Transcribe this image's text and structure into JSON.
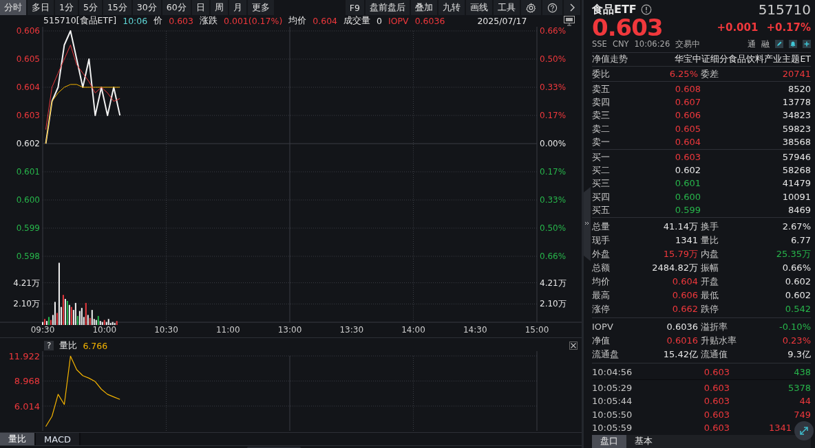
{
  "toolbar": {
    "periods": [
      {
        "label": "分时",
        "selected": true
      },
      {
        "label": "多日",
        "selected": false
      },
      {
        "label": "1分",
        "selected": false
      },
      {
        "label": "5分",
        "selected": false
      },
      {
        "label": "15分",
        "selected": false
      },
      {
        "label": "30分",
        "selected": false
      },
      {
        "label": "60分",
        "selected": false
      },
      {
        "label": "日",
        "selected": false
      },
      {
        "label": "周",
        "selected": false
      },
      {
        "label": "月",
        "selected": false
      },
      {
        "label": "更多",
        "selected": false
      }
    ],
    "tools": [
      "F9",
      "盘前盘后",
      "叠加",
      "九转",
      "画线",
      "工具"
    ]
  },
  "chart_header": {
    "code_name": "515710[食品ETF]",
    "time": "10:06",
    "price_label": "价",
    "price": "0.603",
    "change_label": "涨跌",
    "change": "0.001(0.17%)",
    "avg_label": "均价",
    "avg": "0.604",
    "volume_label": "成交量",
    "volume": "0",
    "iopv_label": "IOPV",
    "iopv": "0.6036",
    "date": "2025/07/17"
  },
  "price_chart": {
    "percent_ticks": [
      "0.66%",
      "0.50%",
      "0.33%",
      "0.17%",
      "0.00%",
      "0.17%",
      "0.33%",
      "0.50%",
      "0.66%"
    ],
    "chart_data": {
      "type": "line",
      "grid": true,
      "categories": [
        null,
        null,
        null,
        null,
        null,
        null,
        null,
        null,
        null,
        null,
        null,
        null,
        null,
        null,
        null,
        null,
        null,
        null,
        null,
        null,
        null,
        null,
        null,
        null,
        null,
        null,
        null,
        null,
        null,
        null,
        null,
        null,
        null,
        null,
        null,
        null,
        null,
        null,
        null,
        null,
        null,
        null,
        null,
        null,
        null,
        null,
        null,
        null,
        null,
        null,
        null,
        null,
        null,
        null,
        null,
        null,
        null,
        null,
        null,
        null,
        null,
        null,
        null,
        null,
        null,
        null,
        null,
        null,
        null,
        null,
        null,
        null,
        null,
        null,
        null,
        null,
        null,
        null,
        null,
        null
      ],
      "ylim": [
        0.598,
        0.606
      ],
      "yticks": [
        {
          "value": 0.606,
          "label": "0.606"
        },
        {
          "value": 0.605,
          "label": "0.605"
        },
        {
          "value": 0.604,
          "label": "0.604"
        },
        {
          "value": 0.603,
          "label": "0.603"
        },
        {
          "value": 0.602,
          "label": "0.602"
        },
        {
          "value": 0.601,
          "label": "0.601"
        },
        {
          "value": 0.6,
          "label": "0.600"
        },
        {
          "value": 0.599,
          "label": "0.599"
        },
        {
          "value": 0.598,
          "label": "0.598"
        }
      ],
      "series": [
        {
          "color": "#f2f2f2",
          "values": [
            0.602,
            0.6035,
            0.604,
            0.6055,
            0.606,
            0.605,
            0.604,
            0.605,
            0.603,
            0.604,
            0.603,
            0.604,
            0.603,
            null,
            null,
            null,
            null,
            null,
            null,
            null,
            null,
            null,
            null,
            null,
            null,
            null,
            null,
            null,
            null,
            null,
            null,
            null,
            null,
            null,
            null,
            null,
            null,
            null,
            null,
            null,
            null,
            null,
            null,
            null,
            null,
            null,
            null,
            null,
            null,
            null,
            null,
            null,
            null,
            null,
            null,
            null,
            null,
            null,
            null,
            null,
            null,
            null,
            null,
            null,
            null,
            null,
            null,
            null,
            null,
            null,
            null,
            null,
            null,
            null,
            null,
            null,
            null,
            null,
            null,
            null
          ]
        },
        {
          "color": "#f5b400",
          "values": [
            0.602,
            0.6035,
            0.6038,
            0.604,
            0.6041,
            0.6041,
            0.604,
            0.604,
            0.604,
            0.604,
            0.604,
            0.604,
            0.604,
            null,
            null,
            null,
            null,
            null,
            null,
            null,
            null,
            null,
            null,
            null,
            null,
            null,
            null,
            null,
            null,
            null,
            null,
            null,
            null,
            null,
            null,
            null,
            null,
            null,
            null,
            null,
            null,
            null,
            null,
            null,
            null,
            null,
            null,
            null,
            null,
            null,
            null,
            null,
            null,
            null,
            null,
            null,
            null,
            null,
            null,
            null,
            null,
            null,
            null,
            null,
            null,
            null,
            null,
            null,
            null,
            null,
            null,
            null,
            null,
            null,
            null,
            null,
            null,
            null,
            null,
            null
          ]
        },
        {
          "color": "#e8383d",
          "values": [
            0.6025,
            0.604,
            0.6045,
            0.605,
            0.6055,
            0.6048,
            0.6045,
            0.6042,
            0.6038,
            0.604,
            0.6038,
            0.6035,
            0.6036,
            null,
            null,
            null,
            null,
            null,
            null,
            null,
            null,
            null,
            null,
            null,
            null,
            null,
            null,
            null,
            null,
            null,
            null,
            null,
            null,
            null,
            null,
            null,
            null,
            null,
            null,
            null,
            null,
            null,
            null,
            null,
            null,
            null,
            null,
            null,
            null,
            null,
            null,
            null,
            null,
            null,
            null,
            null,
            null,
            null,
            null,
            null,
            null,
            null,
            null,
            null,
            null,
            null,
            null,
            null,
            null,
            null,
            null,
            null,
            null,
            null,
            null,
            null,
            null,
            null,
            null,
            null
          ]
        }
      ]
    }
  },
  "volume_chart": {
    "right_ticks": [
      "4.21万",
      "2.10万"
    ],
    "later_time_labels": [
      "10:30",
      "11:00",
      "13:00",
      "13:30",
      "14:00",
      "14:30",
      "15:00"
    ],
    "chart_data": {
      "type": "bar",
      "stacked": true,
      "grid": true,
      "categories": [
        "09:30",
        null,
        null,
        null,
        null,
        null,
        null,
        null,
        null,
        null,
        null,
        null,
        null,
        null,
        null,
        null,
        null,
        null,
        null,
        null,
        null,
        null,
        null,
        null,
        null,
        null,
        null,
        null,
        null,
        null,
        "10:00",
        null,
        null,
        null,
        null,
        null,
        null
      ],
      "ylim": [
        0,
        6.3
      ],
      "yticks": [
        {
          "value": 4.21,
          "label": "4.21万"
        },
        {
          "value": 2.1,
          "label": "2.10万"
        }
      ],
      "series": [
        {
          "color": "#e8383d",
          "values": [
            null,
            0.6,
            null,
            null,
            0.5,
            null,
            null,
            1.2,
            null,
            null,
            3.0,
            null,
            null,
            null,
            1.8,
            null,
            null,
            null,
            null,
            null,
            null,
            2.2,
            null,
            0.7,
            null,
            null,
            null,
            null,
            null,
            null,
            0.5,
            null,
            null,
            null,
            null,
            null,
            0.4
          ]
        },
        {
          "color": "#25b84c",
          "values": [
            null,
            null,
            null,
            0.8,
            null,
            null,
            null,
            null,
            null,
            null,
            null,
            null,
            2.4,
            null,
            null,
            null,
            null,
            0.9,
            null,
            null,
            null,
            null,
            null,
            null,
            null,
            null,
            null,
            0.9,
            null,
            null,
            null,
            null,
            null,
            null,
            null,
            null,
            null
          ]
        },
        {
          "color": "#f2f2f2",
          "values": [
            0.3,
            null,
            0.4,
            null,
            null,
            1.0,
            2.3,
            null,
            6.2,
            1.8,
            null,
            2.6,
            null,
            2.0,
            null,
            1.5,
            2.2,
            null,
            1.4,
            1.7,
            0.8,
            null,
            1.0,
            null,
            1.5,
            0.6,
            0.5,
            null,
            0.4,
            0.3,
            null,
            0.3,
            0.6,
            0.2,
            0.3,
            0.2,
            null
          ]
        }
      ]
    }
  },
  "indicator": {
    "help": "?",
    "name": "量比",
    "value": "6.766",
    "chart_data": {
      "type": "line",
      "grid": true,
      "categories": [
        null,
        null,
        null,
        null,
        null,
        null,
        null,
        null,
        null,
        null,
        null,
        null,
        null,
        null,
        null,
        null,
        null,
        null,
        null,
        null,
        null,
        null,
        null,
        null,
        null,
        null,
        null,
        null,
        null,
        null,
        null,
        null,
        null,
        null,
        null,
        null,
        null,
        null,
        null,
        null,
        null,
        null,
        null,
        null,
        null,
        null,
        null,
        null,
        null,
        null,
        null,
        null,
        null,
        null,
        null,
        null,
        null,
        null,
        null,
        null,
        null,
        null,
        null,
        null,
        null,
        null,
        null,
        null,
        null,
        null,
        null,
        null,
        null,
        null,
        null,
        null,
        null,
        null,
        null,
        null
      ],
      "ylim": [
        3.18,
        11.922
      ],
      "yticks": [
        {
          "value": 11.922,
          "label": "11.922"
        },
        {
          "value": 8.968,
          "label": "8.968"
        },
        {
          "value": 6.014,
          "label": "6.014"
        }
      ],
      "series": [
        {
          "color": "#f5b400",
          "values": [
            3.6,
            4.8,
            7.4,
            6.2,
            11.9,
            10.3,
            9.6,
            9.3,
            8.9,
            8.0,
            7.4,
            7.1,
            6.8,
            null,
            null,
            null,
            null,
            null,
            null,
            null,
            null,
            null,
            null,
            null,
            null,
            null,
            null,
            null,
            null,
            null,
            null,
            null,
            null,
            null,
            null,
            null,
            null,
            null,
            null,
            null,
            null,
            null,
            null,
            null,
            null,
            null,
            null,
            null,
            null,
            null,
            null,
            null,
            null,
            null,
            null,
            null,
            null,
            null,
            null,
            null,
            null,
            null,
            null,
            null,
            null,
            null,
            null,
            null,
            null,
            null,
            null,
            null,
            null,
            null,
            null,
            null,
            null,
            null,
            null,
            null
          ]
        }
      ]
    }
  },
  "indicator_tabs": [
    {
      "label": "量比",
      "selected": true
    },
    {
      "label": "MACD",
      "selected": false
    }
  ],
  "quote": {
    "name": "食品ETF",
    "code": "515710",
    "price": "0.603",
    "change": "+0.001",
    "change_pct": "+0.17%",
    "exchange": "SSE",
    "currency": "CNY",
    "time": "10:06:26",
    "status": "交易中",
    "tags": [
      "通",
      "融"
    ]
  },
  "nav_row": {
    "label": "净值走势",
    "fund_name": "华宝中证细分食品饮料产业主题ET"
  },
  "order_ratio": {
    "label": "委比",
    "value": "6.25%",
    "diff_label": "委差",
    "diff": "20741"
  },
  "asks": [
    {
      "label": "卖五",
      "price": "0.608",
      "volume": "8520",
      "color": "#f0383c"
    },
    {
      "label": "卖四",
      "price": "0.607",
      "volume": "13778",
      "color": "#f0383c"
    },
    {
      "label": "卖三",
      "price": "0.606",
      "volume": "34823",
      "color": "#f0383c"
    },
    {
      "label": "卖二",
      "price": "0.605",
      "volume": "59823",
      "color": "#f0383c"
    },
    {
      "label": "卖一",
      "price": "0.604",
      "volume": "38568",
      "color": "#f0383c"
    }
  ],
  "bids": [
    {
      "label": "买一",
      "price": "0.603",
      "volume": "57946",
      "color": "#f0383c"
    },
    {
      "label": "买二",
      "price": "0.602",
      "volume": "58268",
      "color": "#e8e8e8"
    },
    {
      "label": "买三",
      "price": "0.601",
      "volume": "41479",
      "color": "#27b64b"
    },
    {
      "label": "买四",
      "price": "0.600",
      "volume": "10091",
      "color": "#27b64b"
    },
    {
      "label": "买五",
      "price": "0.599",
      "volume": "8469",
      "color": "#27b64b"
    }
  ],
  "stats": [
    {
      "label": "总量",
      "value": "41.14万",
      "color": "#e8e8e8"
    },
    {
      "label": "换手",
      "value": "2.67%",
      "color": "#e8e8e8"
    },
    {
      "label": "现手",
      "value": "1341",
      "color": "#e8e8e8"
    },
    {
      "label": "量比",
      "value": "6.77",
      "color": "#e8e8e8"
    },
    {
      "label": "外盘",
      "value": "15.79万",
      "color": "#f0383c"
    },
    {
      "label": "内盘",
      "value": "25.35万",
      "color": "#27b64b"
    },
    {
      "label": "总额",
      "value": "2484.82万",
      "color": "#e8e8e8"
    },
    {
      "label": "振幅",
      "value": "0.66%",
      "color": "#e8e8e8"
    },
    {
      "label": "均价",
      "value": "0.604",
      "color": "#f0383c"
    },
    {
      "label": "开盘",
      "value": "0.602",
      "color": "#e8e8e8"
    },
    {
      "label": "最高",
      "value": "0.606",
      "color": "#f0383c"
    },
    {
      "label": "最低",
      "value": "0.602",
      "color": "#e8e8e8"
    },
    {
      "label": "涨停",
      "value": "0.662",
      "color": "#f0383c"
    },
    {
      "label": "跌停",
      "value": "0.542",
      "color": "#27b64b"
    }
  ],
  "etf_stats": [
    {
      "label": "IOPV",
      "value": "0.6036",
      "color": "#e8e8e8"
    },
    {
      "label": "溢折率",
      "value": "-0.10%",
      "color": "#27b64b"
    },
    {
      "label": "净值",
      "value": "0.6016",
      "color": "#f0383c"
    },
    {
      "label": "升贴水率",
      "value": "0.23%",
      "color": "#f0383c"
    },
    {
      "label": "流通盘",
      "value": "15.42亿",
      "color": "#e8e8e8"
    },
    {
      "label": "流通值",
      "value": "9.3亿",
      "color": "#e8e8e8"
    }
  ],
  "trades": [
    {
      "time": "10:04:56",
      "price": {
        "value": "0.603",
        "color": "#f0383c"
      },
      "volume": {
        "value": "438",
        "color": "#27b64b"
      }
    },
    {
      "time": "10:05:29",
      "price": {
        "value": "0.603",
        "color": "#f0383c"
      },
      "volume": {
        "value": "5378",
        "color": "#27b64b"
      }
    },
    {
      "time": "10:05:44",
      "price": {
        "value": "0.603",
        "color": "#f0383c"
      },
      "volume": {
        "value": "44",
        "color": "#f0383c"
      }
    },
    {
      "time": "10:05:50",
      "price": {
        "value": "0.603",
        "color": "#f0383c"
      },
      "volume": {
        "value": "749",
        "color": "#f0383c"
      }
    },
    {
      "time": "10:05:59",
      "price": {
        "value": "0.603",
        "color": "#f0383c"
      },
      "volume": {
        "value": "1341",
        "color": "#f0383c"
      }
    }
  ],
  "panel_tabs": [
    {
      "label": "盘口",
      "selected": true
    },
    {
      "label": "基本",
      "selected": false
    }
  ]
}
